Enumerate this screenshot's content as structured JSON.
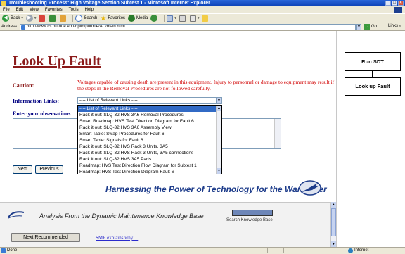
{
  "window": {
    "title": "Troubleshooting Process: High Voltage Section Subtest 1 - Microsoft Internet Explorer"
  },
  "menu": [
    "File",
    "Edit",
    "View",
    "Favorites",
    "Tools",
    "Help"
  ],
  "toolbar": {
    "back": "Back",
    "search": "Search",
    "favorites": "Favorites",
    "media": "Media"
  },
  "address": {
    "label": "Address",
    "url": "http://www.cs.purdue.edu/hplib/purdue/AC/main.html",
    "go": "Go",
    "links": "Links"
  },
  "page": {
    "title": "Look Up Fault",
    "caution_label": "Caution:",
    "caution_text": "Voltages capable of causing death are present in this equipment. Injury to personnel or damage to equipment may result if the steps in the Removal Procedures are not followed carefully.",
    "info_links_label": "Information Links:",
    "enter_observations_label": "Enter your observations",
    "select_value": "---- List of Relevant Links ----",
    "dropdown_options": [
      "---- List of Relevant Links ----",
      "Rack it out: SLQ-32 HVS 3A6 Removal Procedures",
      "Smart Roadmap: HVS Test Direction Diagram for Fault 6",
      "Rack it out: SLQ-32 HVS 3A6 Assembly View",
      "Smart Table: Swap Procedures for Fault 6",
      "Smart Table: Signals for Fault 6",
      "Rack it out: SLQ-32 HVS Rack 3 Units, 3A5",
      "Rack it out: SLQ-32 HVS Rack 3 Units, 3A5 connections",
      "Rack it out: SLQ-32 HVS 3A5 Parts",
      "Roadmap: HVS Test Direction Flow Diagram for Subtest 1",
      "Roadmap: HVS Test Direction Diagram Fault 6"
    ],
    "next_button": "Next",
    "previous_button": "Previous",
    "tagline": "Harnessing the Power of Technology for the Warfighter"
  },
  "knowledge_base": {
    "title": "Analysis From the  Dynamic Maintenance Knowledge Base",
    "search_label": "Search Knowledge Base",
    "next_recommended": "Next Recommended",
    "sme_link": "SME explains why ..."
  },
  "flow": {
    "run_sdt": "Run SDT",
    "look_up_fault": "Look up Fault"
  },
  "status": {
    "text": "Done",
    "zone": "Internet"
  }
}
